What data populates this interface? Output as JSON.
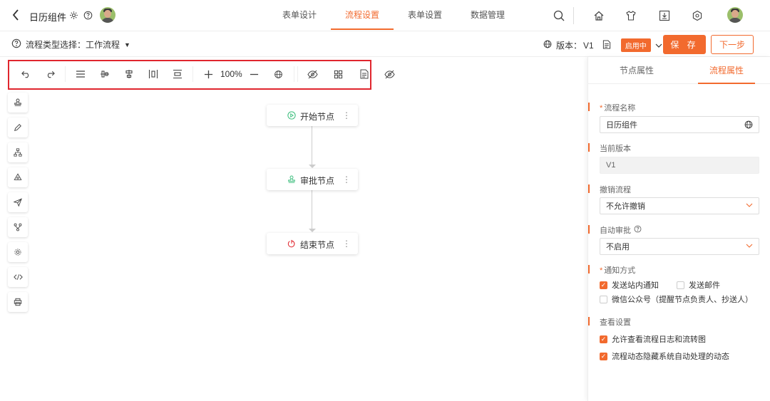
{
  "header": {
    "back_label": "<",
    "app_title": "日历组件",
    "tabs": [
      {
        "label": "表单设计",
        "active": false
      },
      {
        "label": "流程设置",
        "active": true
      },
      {
        "label": "表单设置",
        "active": false
      },
      {
        "label": "数据管理",
        "active": false
      }
    ],
    "icons": [
      "search-icon",
      "home-icon",
      "shirt-icon",
      "download-icon",
      "settings-icon",
      "avatar"
    ]
  },
  "subbar": {
    "flow_type_label": "流程类型选择：工作流程",
    "version_label": "版本：",
    "version_value": "V1",
    "status_badge": "启用中",
    "save_label": "保 存",
    "next_label": "下一步"
  },
  "toolbar": {
    "zoom": "100%"
  },
  "canvas": {
    "nodes": [
      {
        "label": "开始节点",
        "icon": "play-circle-icon",
        "color": "#3fbf7f"
      },
      {
        "label": "审批节点",
        "icon": "stamp-icon",
        "color": "#3fbf7f"
      },
      {
        "label": "结束节点",
        "icon": "power-icon",
        "color": "#e0262e"
      }
    ],
    "more_label": "⋮"
  },
  "panel": {
    "tabs": [
      {
        "label": "节点属性",
        "active": false
      },
      {
        "label": "流程属性",
        "active": true
      }
    ],
    "flow_name": {
      "label": "流程名称",
      "value": "日历组件"
    },
    "current_version": {
      "label": "当前版本",
      "value": "V1"
    },
    "revoke": {
      "label": "撤销流程",
      "value": "不允许撤销"
    },
    "auto_approve": {
      "label": "自动审批",
      "value": "不启用"
    },
    "notify": {
      "label": "通知方式",
      "options": [
        {
          "label": "发送站内通知",
          "checked": true
        },
        {
          "label": "发送邮件",
          "checked": false
        },
        {
          "label": "微信公众号（提醒节点负责人、抄送人）",
          "checked": false
        }
      ]
    },
    "view": {
      "label": "查看设置",
      "options": [
        {
          "label": "允许查看流程日志和流转图",
          "checked": true
        },
        {
          "label": "流程动态隐藏系统自动处理的动态",
          "checked": true
        }
      ]
    }
  },
  "colors": {
    "accent": "#f26a2e",
    "highlight_frame": "#e0262e"
  }
}
